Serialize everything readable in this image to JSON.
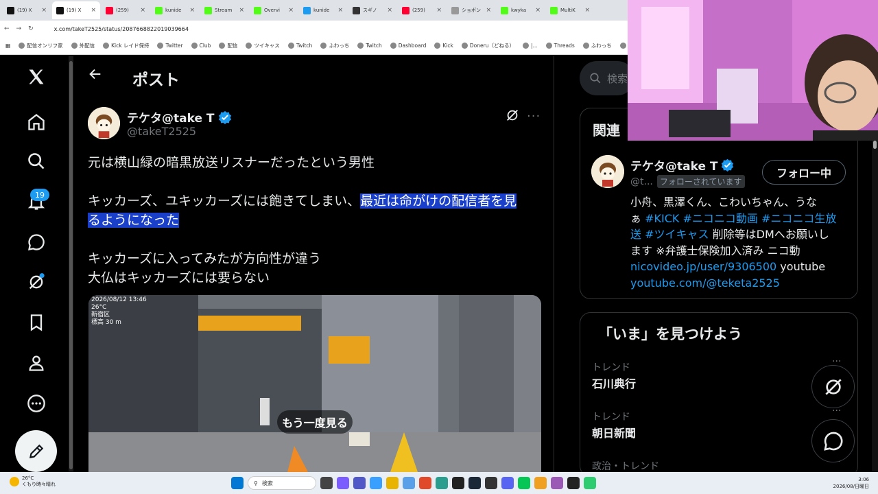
{
  "browser": {
    "tabs": [
      {
        "label": "(19) X",
        "color": "#111111"
      },
      {
        "label": "(19) X",
        "color": "#111111"
      },
      {
        "label": "(259)",
        "color": "#ff0033"
      },
      {
        "label": "kunide",
        "color": "#53fc18"
      },
      {
        "label": "Stream",
        "color": "#53fc18"
      },
      {
        "label": "Overvi",
        "color": "#53fc18"
      },
      {
        "label": "kunide",
        "color": "#1d9bf0"
      },
      {
        "label": "スギノ",
        "color": "#333333"
      },
      {
        "label": "(259)",
        "color": "#ff0033"
      },
      {
        "label": "ショポン",
        "color": "#999999"
      },
      {
        "label": "kwyka",
        "color": "#53fc18"
      },
      {
        "label": "MultiK",
        "color": "#53fc18"
      }
    ],
    "url": "x.com/takeT2525/status/2087668822019039664",
    "bookmarks": [
      "配信オンリフ家",
      "外配信",
      "Kick レイド保持",
      "Twitter",
      "Club",
      "配信",
      "ツイキャス",
      "Twitch",
      "ふわっち",
      "Twitch",
      "Dashboard",
      "Kick",
      "Doneru（どねる）",
      "|...",
      "Threads",
      "ふわっち",
      "Yahoo"
    ]
  },
  "nav": {
    "notification_count": "19"
  },
  "post": {
    "header_title": "ポスト",
    "author_name": "テケタ@take T",
    "author_handle": "@takeT2525",
    "lines": [
      "元は横山緑の暗黒放送リスナーだったという男性",
      "キッカーズ、ユキッカーズには飽きてしまい、",
      "最近は命がけの配信者を見",
      "るようになった",
      "キッカーズに入ってみたが方向性が違う",
      "大仏はキッカーズには要らない"
    ],
    "media": {
      "timestamp": "2026/08/12 13:46",
      "temperature": "26°C",
      "location": "新宿区",
      "altitude": "標高 30 m",
      "replay_label": "もう一度見る"
    }
  },
  "sidebar": {
    "search_placeholder": "検索",
    "relevant_title": "関連",
    "profile": {
      "name": "テケタ@take T",
      "handle": "@t...",
      "follows_you": "フォローされています",
      "follow_button": "フォロー中",
      "bio_1": "小舟、黒澤くん、こわいちゃん、うな",
      "bio_2a": "ぁ ",
      "tag1": "#KICK",
      "tag2": "#ニコニコ動画",
      "tag3": "#ニコニコ生放",
      "tag3b": "送",
      "tag4": "#ツイキャス",
      "bio_3": " 削除等はDMへお願いし",
      "bio_4": "ます ※弁護士保険加入済み ニコ動",
      "link1": "nicovideo.jp/user/9306500",
      "bio_5": " youtube",
      "link2": "youtube.com/@teketa2525"
    },
    "trends_title": "「いま」を見つけよう",
    "trends": [
      {
        "category": "トレンド",
        "name": "石川典行"
      },
      {
        "category": "トレンド",
        "name": "朝日新聞"
      },
      {
        "category": "政治・トレンド",
        "name": ""
      }
    ]
  },
  "taskbar": {
    "weather_temp": "26°C",
    "weather_desc": "くもり時々晴れ",
    "search_label": "検索",
    "time": "3:06",
    "date": "2026/08/日曜日"
  },
  "colors": {
    "accent": "#1d9bf0",
    "highlight": "#1a3fc8"
  }
}
